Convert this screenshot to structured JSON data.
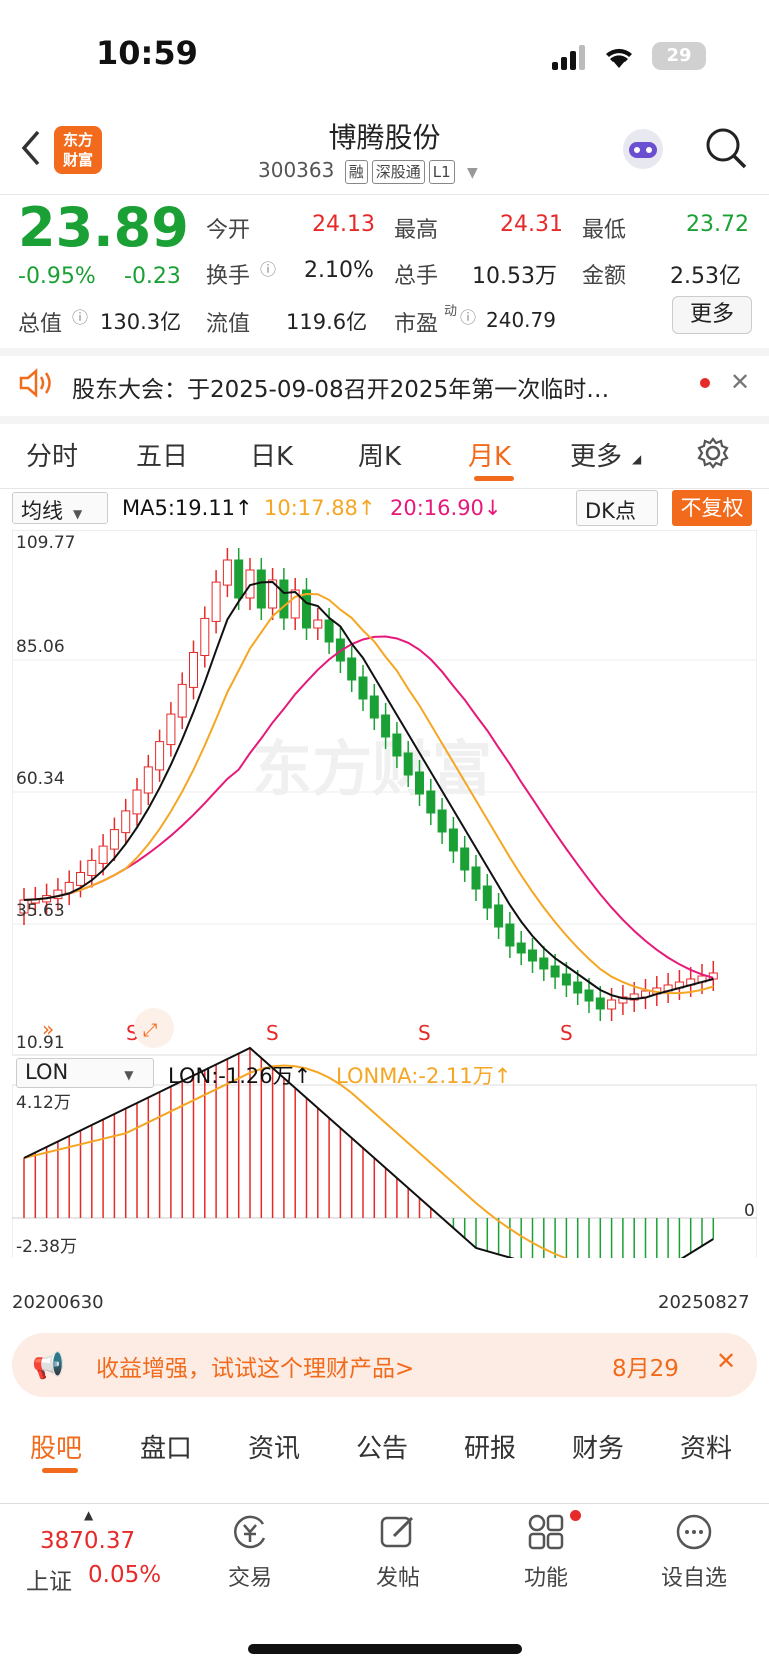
{
  "status_bar": {
    "time": "10:59",
    "battery": "29"
  },
  "header": {
    "logo": "东方财富",
    "title": "博腾股份",
    "code": "300363",
    "tags": [
      "融",
      "深股通",
      "L1"
    ]
  },
  "quote": {
    "price": "23.89",
    "change_pct": "-0.95%",
    "change_amt": "-0.23",
    "today_open_label": "今开",
    "today_open": "24.13",
    "high_label": "最高",
    "high": "24.31",
    "low_label": "最低",
    "low": "23.72",
    "turnover_label": "换手",
    "turnover": "2.10%",
    "volume_label": "总手",
    "volume": "10.53万",
    "amount_label": "金额",
    "amount": "2.53亿",
    "mcap_label": "总值",
    "mcap": "130.3亿",
    "float_label": "流值",
    "float": "119.6亿",
    "pe_label": "市盈",
    "pe_sup": "动",
    "pe": "240.79",
    "more": "更多"
  },
  "notice": {
    "text": "股东大会：于2025-09-08召开2025年第一次临时…"
  },
  "period_tabs": [
    "分时",
    "五日",
    "日K",
    "周K",
    "月K",
    "更多"
  ],
  "active_tab": "月K",
  "chart": {
    "ma_select": "均线",
    "ma5": "MA5:19.11↑",
    "ma10": "10:17.88↑",
    "ma20": "20:16.90↓",
    "dk": "DK点",
    "fq": "不复权",
    "y_labels": [
      "109.77",
      "85.06",
      "60.34",
      "35.63",
      "10.91"
    ],
    "s_marks": [
      "S",
      "S",
      "S",
      "S"
    ],
    "lon_select": "LON",
    "lon": "LON:-1.26万↑",
    "lonma": "LONMA:-2.11万↑",
    "lon_top": "4.12万",
    "lon_zero": "0",
    "lon_bottom": "-2.38万",
    "date_start": "20200630",
    "date_end": "20250827",
    "colors": {
      "up": "#e62a2a",
      "down": "#1aa034",
      "ma5": "#111111",
      "ma10": "#f5a623",
      "ma20": "#e6197a"
    },
    "watermark": "东方财富"
  },
  "chart_data": {
    "type": "candlestick",
    "x_range": [
      "20200630",
      "20250827"
    ],
    "ylim": [
      10.91,
      109.77
    ],
    "last_close": 23.89,
    "lon_range": [
      -2.38,
      4.12
    ]
  },
  "ad": {
    "text": "收益增强，试试这个理财产品>",
    "date": "8月29"
  },
  "bottom_tabs": [
    "股吧",
    "盘口",
    "资讯",
    "公告",
    "研报",
    "财务",
    "资料"
  ],
  "dock": {
    "index_value": "3870.37",
    "index_name": "上证",
    "index_change": "0.05%",
    "items": [
      "交易",
      "发帖",
      "功能",
      "设自选"
    ]
  }
}
